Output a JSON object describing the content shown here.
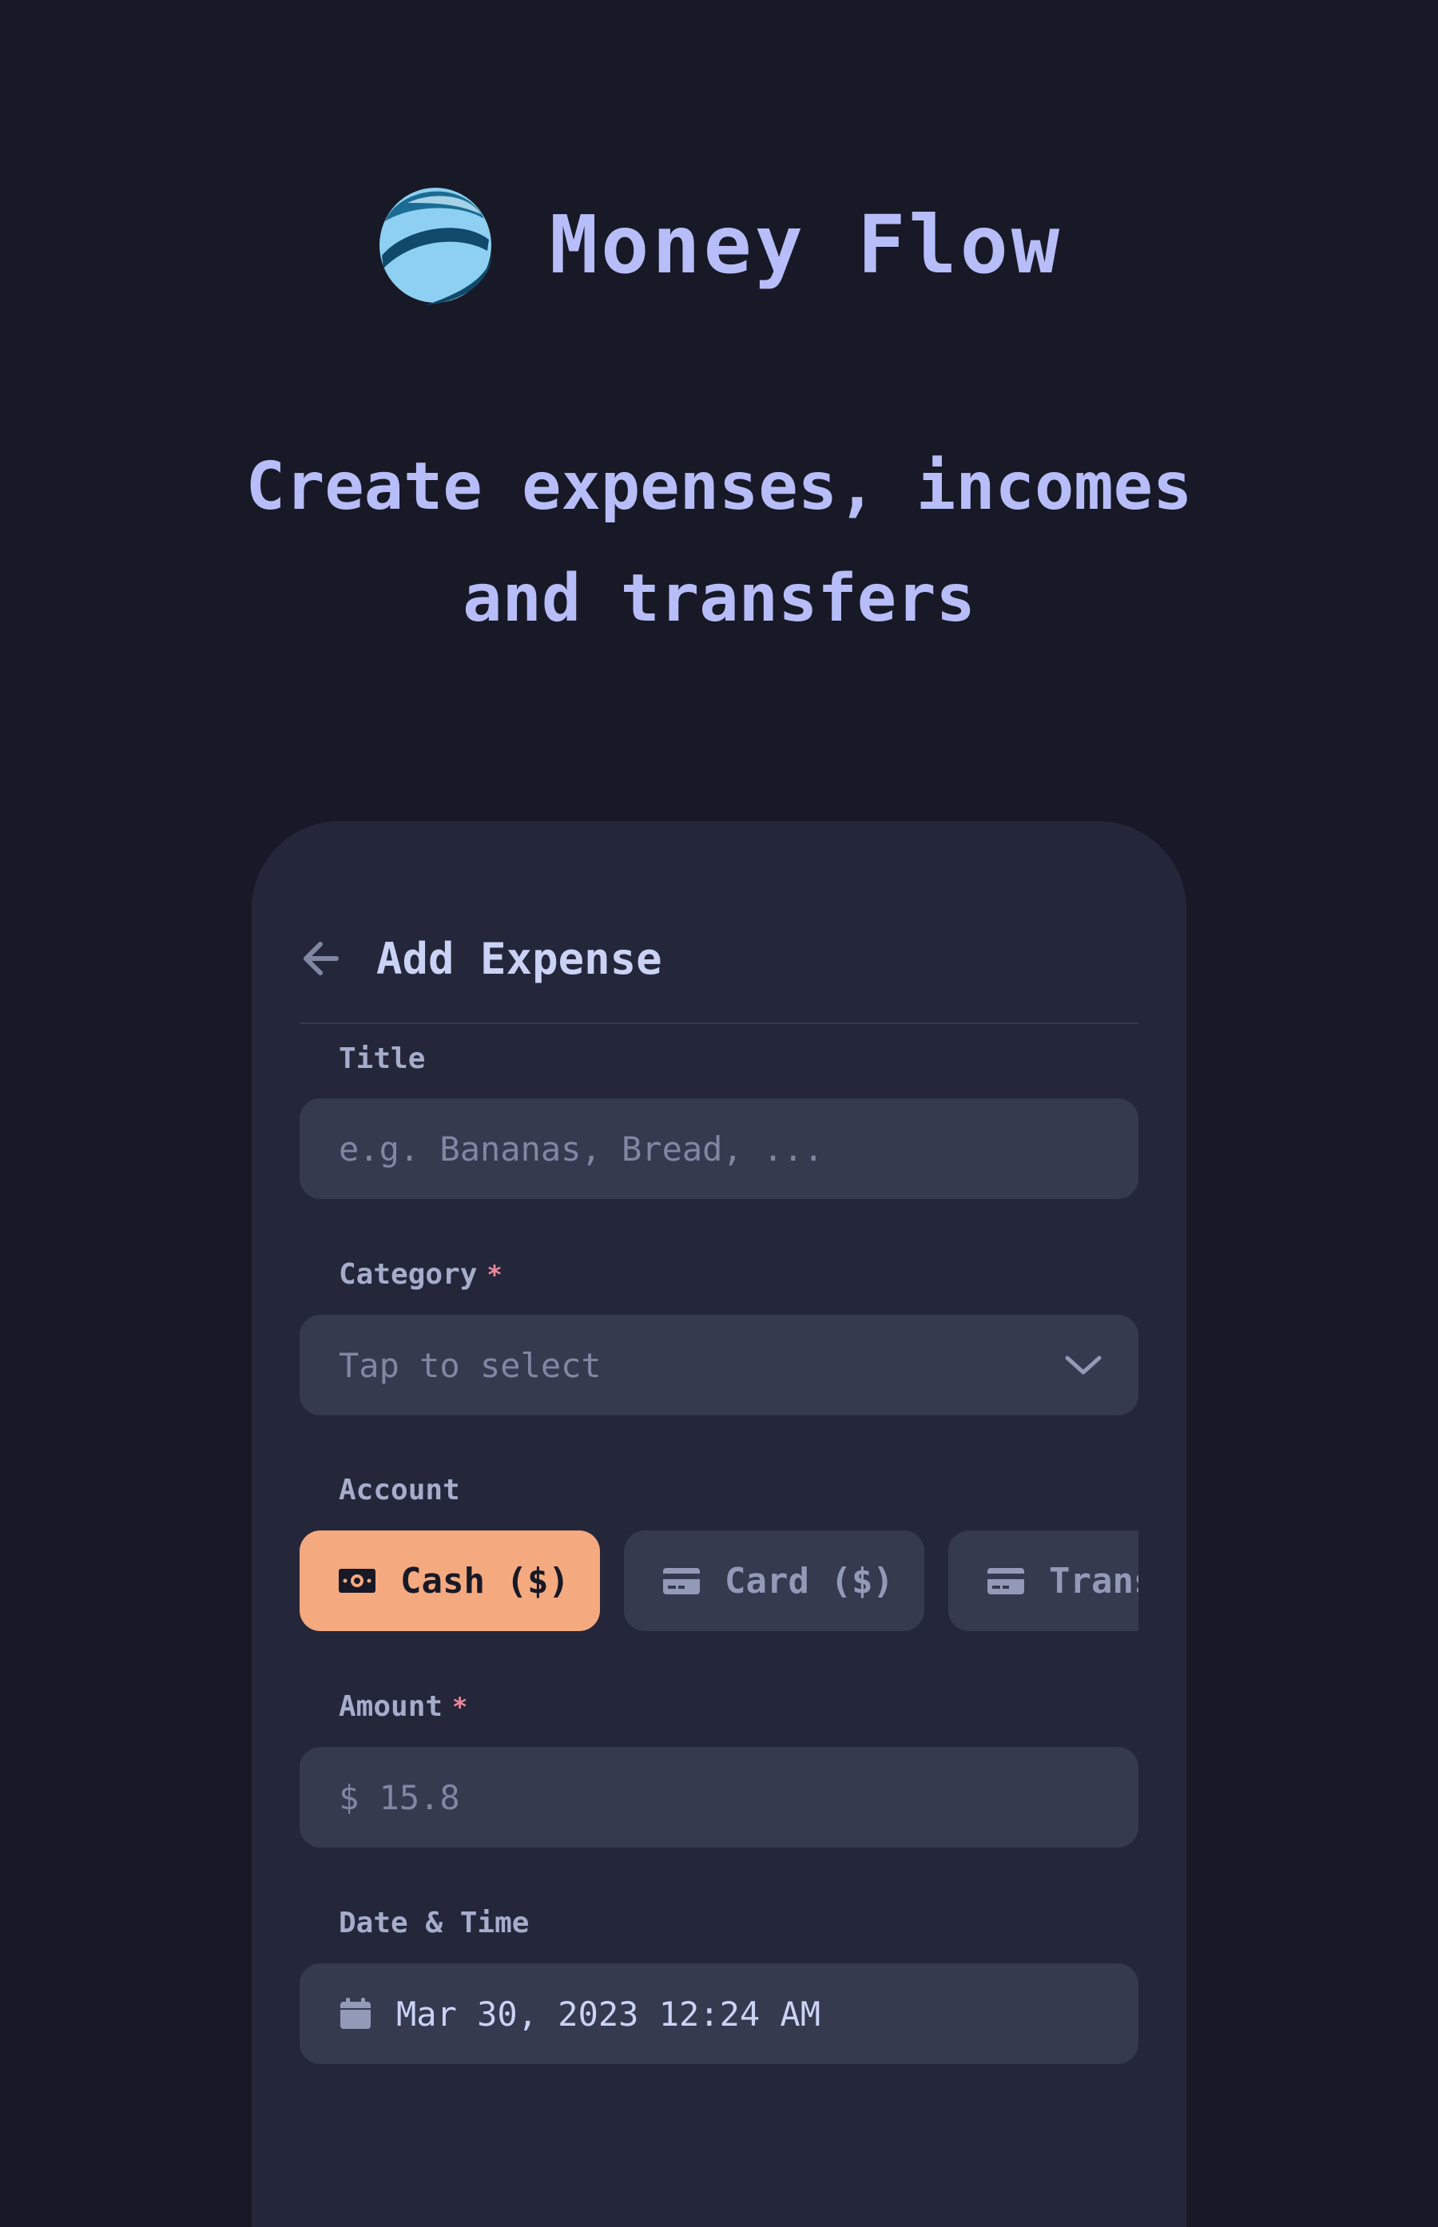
{
  "brand": {
    "logo_icon": "money-flow-logo-icon",
    "name": "Money Flow"
  },
  "headline": {
    "line1": "Create expenses, incomes",
    "line2": "and transfers"
  },
  "screen": {
    "back_icon": "arrow-left-icon",
    "title": "Add Expense"
  },
  "form": {
    "title": {
      "label": "Title",
      "placeholder": "e.g. Bananas, Bread, ..."
    },
    "category": {
      "label": "Category",
      "required_mark": "*",
      "placeholder": "Tap to select",
      "icon": "chevron-down-icon"
    },
    "account": {
      "label": "Account",
      "options": [
        {
          "label": "Cash ($)",
          "icon": "cash-icon",
          "selected": true
        },
        {
          "label": "Card ($)",
          "icon": "credit-card-icon",
          "selected": false
        },
        {
          "label": "Trans",
          "icon": "credit-card-icon",
          "selected": false
        }
      ]
    },
    "amount": {
      "label": "Amount",
      "required_mark": "*",
      "value": "$ 15.8"
    },
    "datetime": {
      "label": "Date & Time",
      "icon": "calendar-icon",
      "value": "Mar 30, 2023 12:24 AM"
    }
  },
  "colors": {
    "background": "#181926",
    "surface": "#24273a",
    "input": "#363a4f",
    "accent": "#b7bdf8",
    "selected_chip": "#f5a97f",
    "required": "#ed8796"
  }
}
